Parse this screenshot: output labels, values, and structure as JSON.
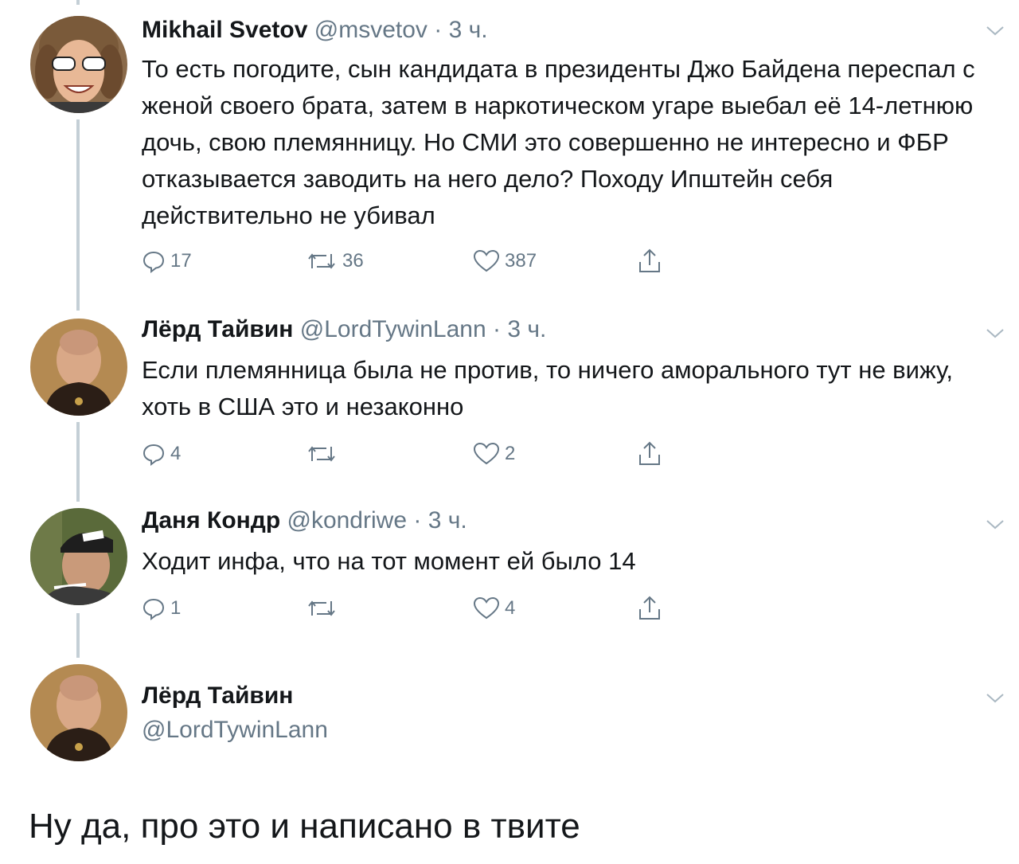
{
  "tweets": [
    {
      "name": "Mikhail Svetov",
      "handle": "@msvetov",
      "separator": "·",
      "time": "3 ч.",
      "text": "То есть погодите, сын кандидата в президенты Джо Байдена переспал с женой своего брата, затем в наркотическом угаре выебал её 14-летнюю дочь, свою племянницу. Но СМИ это совершенно не интересно и ФБР отказывается заводить на него дело? Походу Ипштейн себя действительно не убивал",
      "replies": "17",
      "retweets": "36",
      "likes": "387"
    },
    {
      "name": "Лёрд Тайвин",
      "handle": "@LordTywinLann",
      "separator": "·",
      "time": "3 ч.",
      "text": "Если племянница была не против, то ничего аморального тут не вижу, хоть в США это и незаконно",
      "replies": "4",
      "retweets": "",
      "likes": "2"
    },
    {
      "name": "Даня Кондр",
      "handle": "@kondriwe",
      "separator": "·",
      "time": "3 ч.",
      "text": "Ходит инфа, что на тот момент ей было 14",
      "replies": "1",
      "retweets": "",
      "likes": "4"
    }
  ],
  "reply": {
    "name": "Лёрд Тайвин",
    "handle": "@LordTywinLann"
  },
  "reply_text": "Ну да, про это и написано в твите",
  "icons": {
    "reply": "reply-icon",
    "retweet": "retweet-icon",
    "like": "heart-icon",
    "share": "share-icon",
    "caret": "chevron-down-icon"
  },
  "colors": {
    "text": "#14171a",
    "secondary": "#657786",
    "thread_line": "#c4cfd6"
  }
}
